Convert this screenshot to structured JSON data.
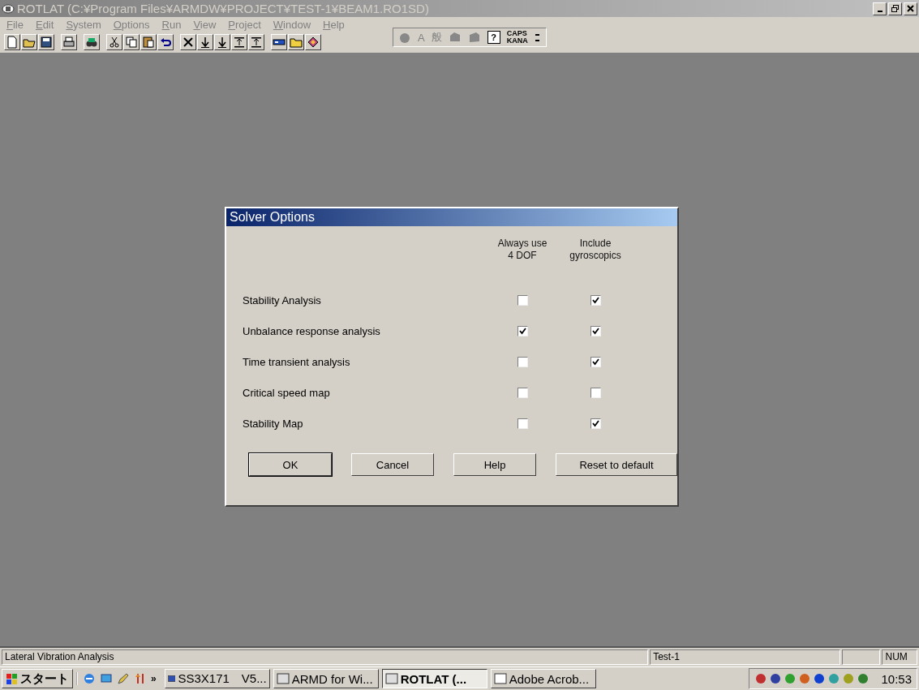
{
  "window": {
    "title": "ROTLAT (C:¥Program Files¥ARMDW¥PROJECT¥TEST-1¥BEAM1.RO1SD)"
  },
  "menu": [
    "File",
    "Edit",
    "System",
    "Options",
    "Run",
    "View",
    "Project",
    "Window",
    "Help"
  ],
  "ime_bar": {
    "mode_a": "A",
    "mode_kanji": "般",
    "help": "?",
    "caps": "CAPS",
    "kana": "KANA"
  },
  "dialog": {
    "title": "Solver Options",
    "columns": [
      "Always use\n4 DOF",
      "Include\ngyroscopics"
    ],
    "rows": [
      {
        "label": "Stability Analysis",
        "four_dof": false,
        "gyroscopics": true
      },
      {
        "label": "Unbalance response analysis",
        "four_dof": true,
        "gyroscopics": true
      },
      {
        "label": "Time transient analysis",
        "four_dof": false,
        "gyroscopics": true
      },
      {
        "label": "Critical speed map",
        "four_dof": false,
        "gyroscopics": false
      },
      {
        "label": "Stability Map",
        "four_dof": false,
        "gyroscopics": true
      }
    ],
    "buttons": [
      {
        "label": "OK",
        "default": true
      },
      {
        "label": "Cancel",
        "default": false
      },
      {
        "label": "Help",
        "default": false
      },
      {
        "label": "Reset to default",
        "default": false
      }
    ]
  },
  "status_bar": [
    "Lateral Vibration Analysis",
    "Test-1",
    "NUM"
  ],
  "taskbar": {
    "start": "スタート",
    "more": "»",
    "tasks": [
      {
        "label": "SS3X171　V5...",
        "selected": false
      },
      {
        "label": "ARMD for Wi...",
        "selected": false
      },
      {
        "label": "ROTLAT (...",
        "selected": true
      },
      {
        "label": "Adobe Acrob...",
        "selected": false
      }
    ],
    "clock": "10:53"
  }
}
